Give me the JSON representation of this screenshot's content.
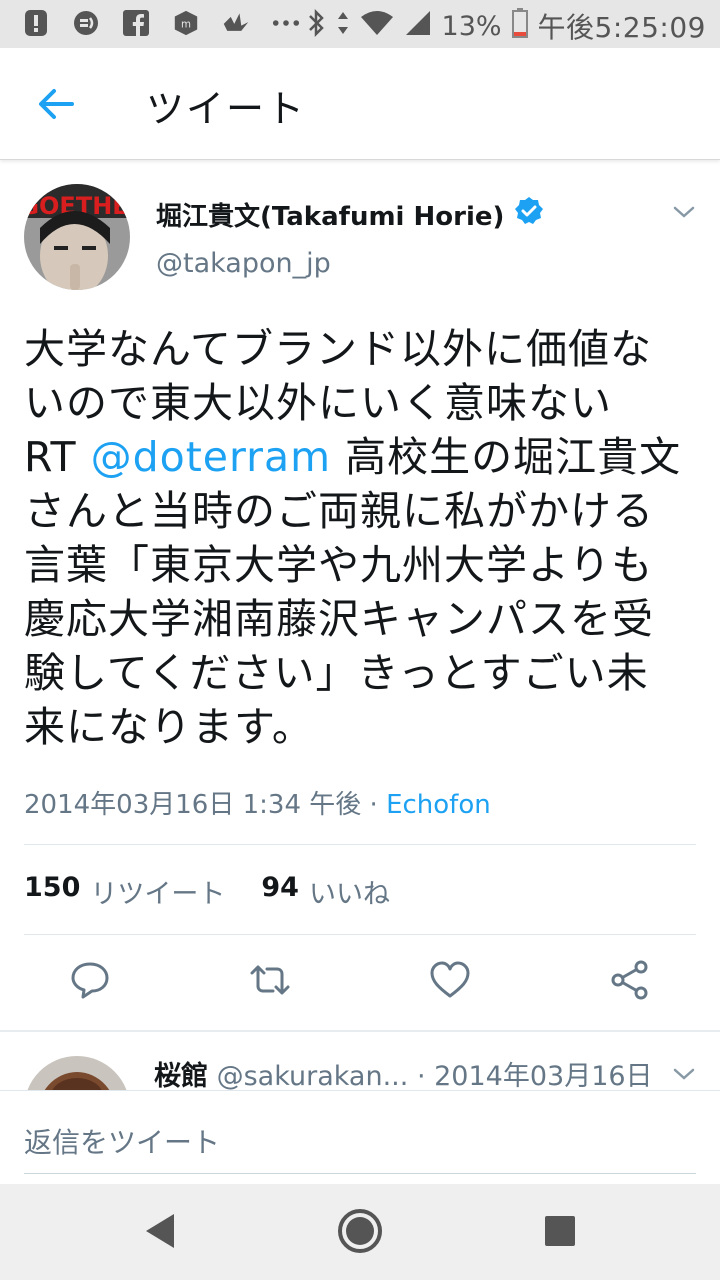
{
  "status_bar": {
    "battery": "13%",
    "time": "午後5:25:09",
    "left_icons": [
      "alert-icon",
      "q-app-icon",
      "facebook-icon",
      "app-icon",
      "bird-icon",
      "more-icon"
    ],
    "right_icons": [
      "bluetooth-icon",
      "data-arrows-icon",
      "wifi-icon",
      "signal-icon",
      "battery-icon"
    ]
  },
  "header": {
    "title": "ツイート"
  },
  "tweet": {
    "author_name": "堀江貴文(Takafumi Horie)",
    "handle": "@takapon_jp",
    "avatar_text": "GOETHE",
    "lines": [
      "大学なんてブランド以外に価値な",
      "いので東大以外にいく意味ない",
      "高校生の堀江貴文",
      "さんと当時のご両親に私がかける",
      "言葉「東京大学や九州大学よりも",
      "慶応大学湘南藤沢キャンパスを受",
      "験してください」きっとすごい未",
      "来になります。"
    ],
    "rt_prefix": "RT",
    "mention": "@doterram",
    "timestamp": "2014年03月16日 1:34 午後",
    "via_separator": "·",
    "source_app": "Echofon",
    "retweet_count": "150",
    "retweet_label": "リツイート",
    "like_count": "94",
    "like_label": "いいね",
    "accent_color": "#1da1f2"
  },
  "reply_preview": {
    "name": "桜館",
    "handle": "@sakurakan...",
    "separator": "·",
    "date": "2014年03月16日"
  },
  "composer": {
    "placeholder": "返信をツイート"
  },
  "nav": {
    "buttons": [
      "back-triangle-icon",
      "home-circle-icon",
      "recents-square-icon"
    ]
  }
}
